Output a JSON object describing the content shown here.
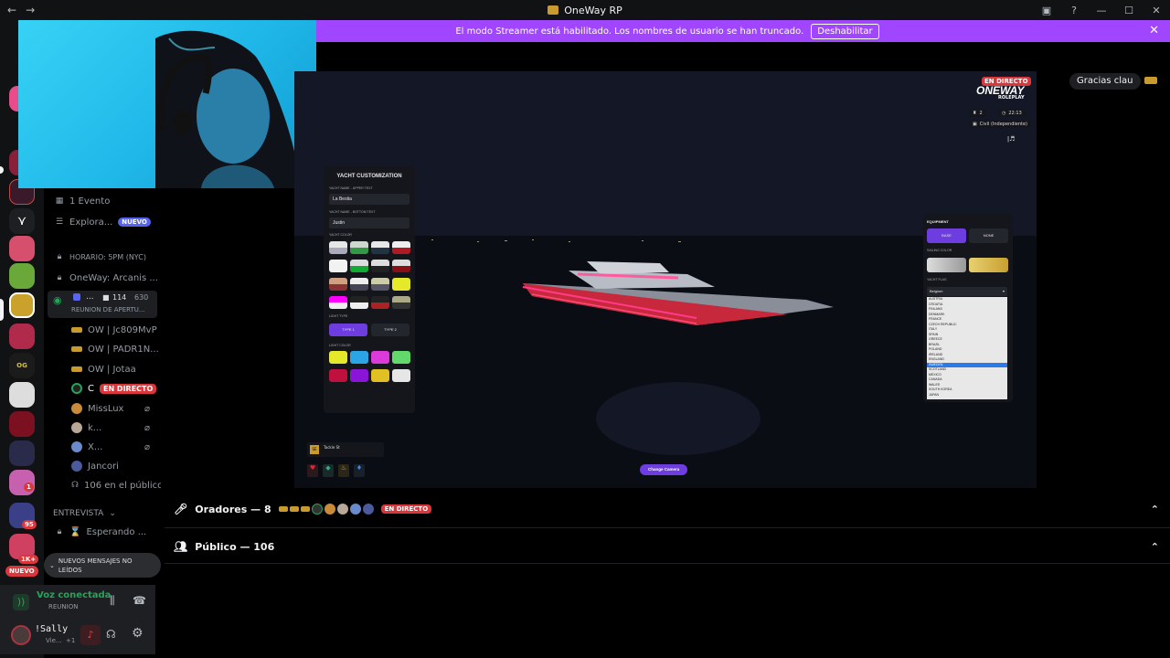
{
  "titlebar": {
    "title": "OneWay RP",
    "nav_back": "←",
    "nav_forward": "→"
  },
  "banner": {
    "text": "El modo Streamer está habilitado. Los nombres de usuario se han truncado.",
    "button": "Deshabilitar",
    "close": "✕"
  },
  "server_badges": {
    "b95": "95",
    "b1k": "1K+",
    "b1": "1",
    "nuevo": "NUEVO"
  },
  "channels": {
    "evento": "1 Evento",
    "explora": "Explora...",
    "explora_badge": "NUEVO",
    "horario": "HORARIO: 5PM (NYC)",
    "oneway": "OneWay: Arcanis ...",
    "stage_dots": "...",
    "stage_video": "114",
    "stage_count": "630",
    "stage_name": "REUNION DE APERTU...",
    "members": [
      {
        "name": "OW | Jc809MvP"
      },
      {
        "name": "OW | PADR1N..."
      },
      {
        "name": "OW | Jotaa"
      },
      {
        "name": "C",
        "live": "EN DIRECTO"
      },
      {
        "name": "MissLux"
      },
      {
        "name": "k..."
      },
      {
        "name": "X..."
      },
      {
        "name": "Jancori"
      }
    ],
    "publico": "106 en el público",
    "entrevista": "ENTREVISTA",
    "esperando": "Esperando ..."
  },
  "new_messages": "NUEVOS MENSAJES NO LEÍDOS",
  "voice": {
    "status": "Voz conectada",
    "channel": "REUNION"
  },
  "user": {
    "name": "!Sally",
    "status": "Vie...",
    "extra": "+1"
  },
  "stream": {
    "live_badge": "EN DIRECTO",
    "viewer_label": "Gracias clau",
    "brand": "ONEWAY",
    "brand_sub": "ROLEPLAY",
    "hud_time": "22:13",
    "hud_players": "2",
    "hud_status": "Civil (Independiente)",
    "yacht_panel": {
      "title": "YACHT CUSTOMIZATION",
      "upper_label": "YACHT NAME - UPPER TEXT",
      "upper_value": "La Bestia",
      "bottom_label": "YACHT NAME - BOTTOM TEXT",
      "bottom_value": "Justin",
      "color_label": "YACHT COLOR",
      "light_type_label": "LIGHT TYPE",
      "type1": "TYPE 1",
      "type2": "TYPE 2",
      "light_color_label": "LIGHT COLOR"
    },
    "equipment_panel": {
      "title": "EQUIPMENT",
      "btn1": "BASE",
      "btn2": "NONE",
      "sailing_label": "SAILING COLOR",
      "flag_label": "YACHT FLAG",
      "flag_selected": "Belgium",
      "flags": [
        "AUSTRIA",
        "CROATIA",
        "FINLAND",
        "DENMARK",
        "FRANCE",
        "CZECH REPUBLIC",
        "ITALY",
        "SPAIN",
        "GREECE",
        "BRAZIL",
        "POLAND",
        "IRELAND",
        "ENGLAND",
        "SWEDEN",
        "SCOTLAND",
        "MEXICO",
        "CANADA",
        "WALES",
        "SOUTH KOREA",
        "JAPAN"
      ]
    },
    "location": "Tackle St",
    "change_camera": "Change Camera",
    "colors": {
      "hull_light": [
        "#e4e6e8",
        "#cfd8cf",
        "#e7e7e7",
        "#b01a24"
      ],
      "light_colors": [
        "#e6e82a",
        "#2ba5e6",
        "#d93ad9",
        "#63d86b",
        "#c0103d",
        "#8a14d8",
        "#e0c022",
        "#e6e6e6"
      ]
    }
  },
  "stage_bars": {
    "oradores": "Oradores — 8",
    "oradores_live": "EN DIRECTO",
    "publico": "Público — 106"
  }
}
